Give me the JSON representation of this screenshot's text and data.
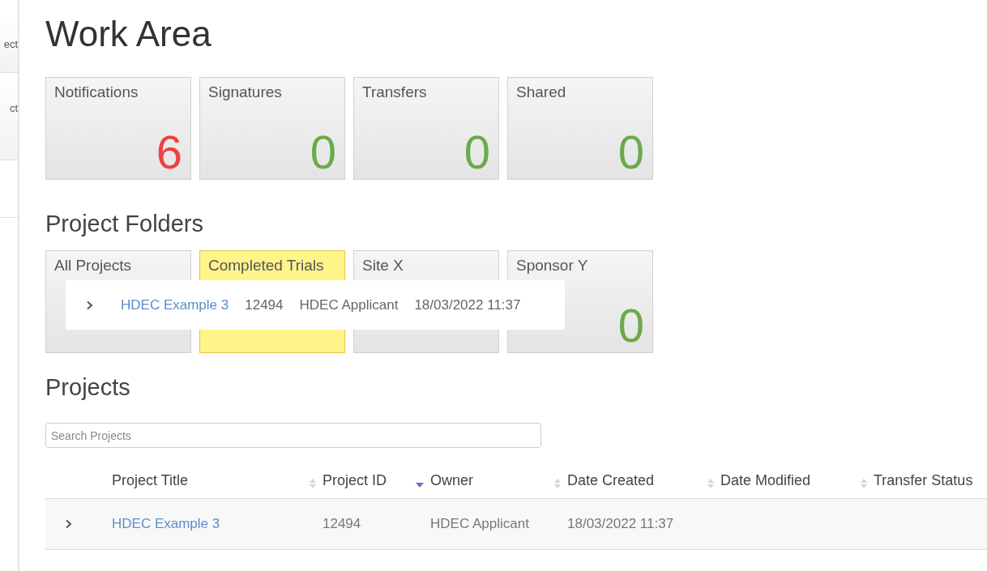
{
  "sidebar": {
    "items": [
      {
        "label": "ect"
      },
      {
        "label": "ct"
      }
    ]
  },
  "title": "Work Area",
  "summary_tiles": [
    {
      "label": "Notifications",
      "count": "6",
      "color": "#f04040",
      "selected": false
    },
    {
      "label": "Signatures",
      "count": "0",
      "color": "#6aaa4a",
      "selected": false
    },
    {
      "label": "Transfers",
      "count": "0",
      "color": "#6aaa4a",
      "selected": false
    },
    {
      "label": "Shared",
      "count": "0",
      "color": "#6aaa4a",
      "selected": false
    }
  ],
  "folders_heading": "Project Folders",
  "folder_tiles": [
    {
      "label": "All Projects",
      "selected": false
    },
    {
      "label": "Completed Trials",
      "selected": true
    },
    {
      "label": "Site X",
      "selected": false
    },
    {
      "label": "Sponsor Y",
      "count": "0",
      "color": "#6aaa4a",
      "selected": false
    }
  ],
  "drag_preview": {
    "title": "HDEC Example 3",
    "id": "12494",
    "owner": "HDEC Applicant",
    "created": "18/03/2022 11:37"
  },
  "projects_heading": "Projects",
  "search": {
    "placeholder": "Search Projects"
  },
  "table": {
    "columns": [
      {
        "label": "Project Title",
        "sorted": false
      },
      {
        "label": "Project ID",
        "sorted": true
      },
      {
        "label": "Owner",
        "sorted": false
      },
      {
        "label": "Date Created",
        "sorted": false
      },
      {
        "label": "Date Modified",
        "sorted": false
      },
      {
        "label": "Transfer Status"
      }
    ],
    "rows": [
      {
        "expanded": false,
        "cells": [
          "HDEC Example 3",
          "12494",
          "HDEC Applicant",
          "18/03/2022 11:37",
          "",
          ""
        ]
      }
    ]
  }
}
